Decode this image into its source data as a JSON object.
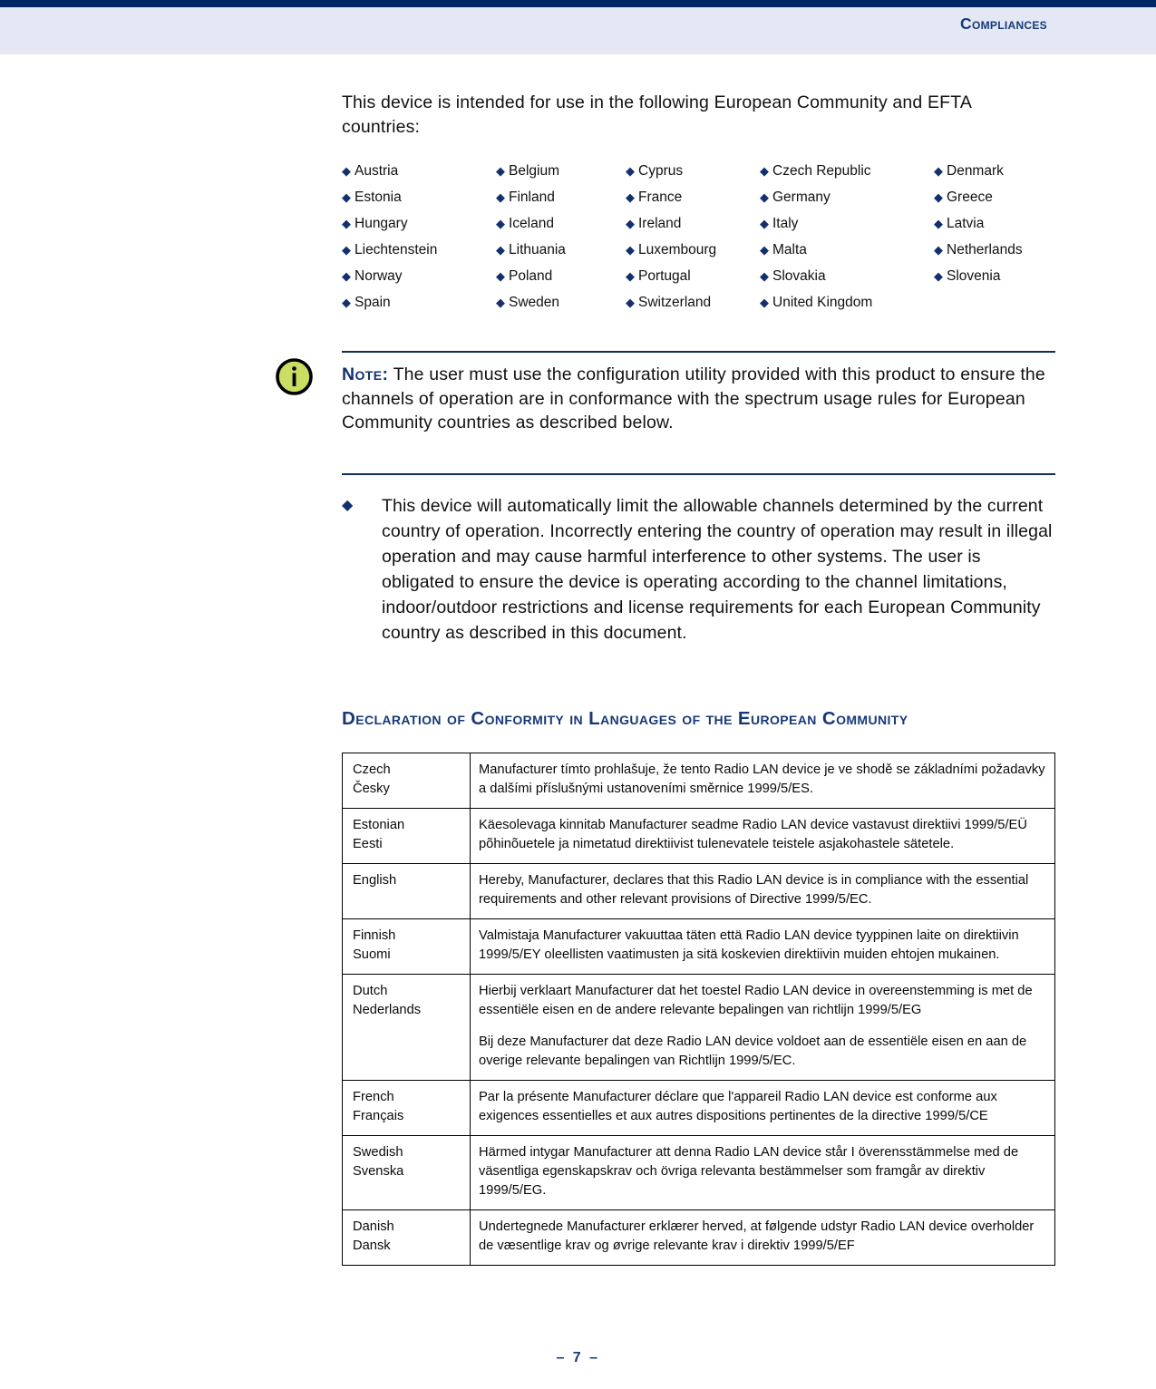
{
  "header": {
    "title": "Compliances",
    "bar_color": "#002663",
    "band_color": "#e3e8f4",
    "title_color": "#173878"
  },
  "intro": {
    "paragraph": "This device is intended for use in the following European Community and EFTA countries:"
  },
  "countries": {
    "bullet_glyph": "◆",
    "bullet_color": "#13306e",
    "list": [
      "Austria",
      "Belgium",
      "Cyprus",
      "Czech Republic",
      "Denmark",
      "Estonia",
      "Finland",
      "France",
      "Germany",
      "Greece",
      "Hungary",
      "Iceland",
      "Ireland",
      "Italy",
      "Latvia",
      "Liechtenstein",
      "Lithuania",
      "Luxembourg",
      "Malta",
      "Netherlands",
      "Norway",
      "Poland",
      "Portugal",
      "Slovakia",
      "Slovenia",
      "Spain",
      "Sweden",
      "Switzerland",
      "United Kingdom"
    ]
  },
  "note": {
    "icon_name": "info-icon",
    "icon_fill": "#cbdd62",
    "icon_stroke": "#000000",
    "label": "Note:",
    "text": " The user must use the configuration utility provided with this product to ensure the channels of operation are in conformance with the spectrum usage rules for European Community countries as described below.",
    "rule_color": "#0f2d5e"
  },
  "bullet": {
    "glyph": "◆",
    "text": "This device will automatically limit the allowable channels determined by the current country of operation. Incorrectly entering the country of operation may result in illegal operation and may cause harmful interference to other systems. The user is obligated to ensure the device is operating according to the channel limitations, indoor/outdoor restrictions and license requirements for each European Community country as described in this document."
  },
  "section": {
    "heading": "Declaration of Conformity in Languages of the European Community"
  },
  "table": {
    "rows": [
      {
        "language": "Czech\nČesky",
        "paragraphs": [
          "Manufacturer tímto prohlašuje, že tento Radio LAN device je ve shodě se základními požadavky a dalšími příslušnými ustanoveními směrnice 1999/5/ES."
        ]
      },
      {
        "language": "Estonian\nEesti",
        "paragraphs": [
          "Käesolevaga kinnitab Manufacturer seadme Radio LAN device vastavust direktiivi 1999/5/EÜ põhinõuetele ja nimetatud direktiivist tulenevatele teistele asjakohastele sätetele."
        ]
      },
      {
        "language": "English",
        "paragraphs": [
          "Hereby, Manufacturer, declares that this Radio LAN device is in compliance with the essential requirements and other relevant provisions of Directive 1999/5/EC."
        ]
      },
      {
        "language": "Finnish\nSuomi",
        "paragraphs": [
          "Valmistaja Manufacturer vakuuttaa täten että Radio LAN device tyyppinen laite on direktiivin 1999/5/EY oleellisten vaatimusten ja sitä koskevien direktiivin muiden ehtojen mukainen."
        ]
      },
      {
        "language": "Dutch\nNederlands",
        "paragraphs": [
          "Hierbij verklaart Manufacturer dat het toestel Radio LAN device in overeenstemming is met de essentiële eisen en de andere relevante bepalingen van richtlijn 1999/5/EG",
          "Bij deze Manufacturer dat deze Radio LAN device voldoet aan de essentiële eisen en aan de overige relevante bepalingen van Richtlijn 1999/5/EC."
        ]
      },
      {
        "language": "French\nFrançais",
        "paragraphs": [
          "Par la présente Manufacturer déclare que l'appareil Radio LAN device est conforme aux exigences essentielles et aux autres dispositions pertinentes de la directive 1999/5/CE"
        ]
      },
      {
        "language": "Swedish\nSvenska",
        "paragraphs": [
          "Härmed intygar Manufacturer att denna Radio LAN device står I överensstämmelse med de väsentliga egenskapskrav och övriga relevanta bestämmelser som framgår av direktiv 1999/5/EG."
        ]
      },
      {
        "language": "Danish\nDansk",
        "paragraphs": [
          "Undertegnede Manufacturer erklærer herved, at følgende udstyr Radio LAN device overholder de væsentlige krav og øvrige relevante krav i direktiv 1999/5/EF"
        ]
      }
    ]
  },
  "footer": {
    "page_marker": "–  7  –"
  }
}
